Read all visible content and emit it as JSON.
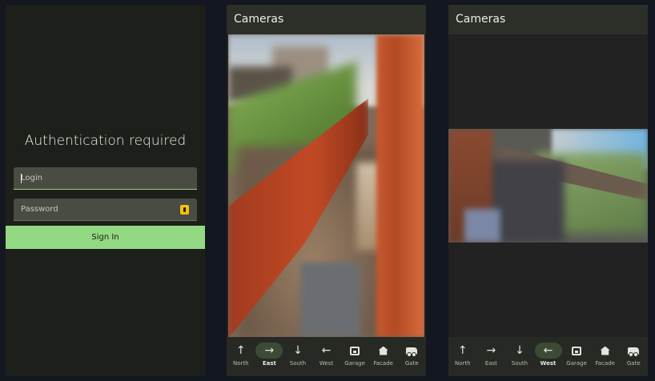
{
  "login": {
    "title": "Authentication required",
    "login_placeholder": "Login",
    "password_placeholder": "Password",
    "sign_in_label": "Sign In"
  },
  "cameras_east": {
    "title": "Cameras",
    "active_tab": "East"
  },
  "cameras_west": {
    "title": "Cameras",
    "active_tab": "West"
  },
  "nav": {
    "items": [
      {
        "label": "North",
        "icon": "arrow-up-icon"
      },
      {
        "label": "East",
        "icon": "arrow-right-icon"
      },
      {
        "label": "South",
        "icon": "arrow-down-icon"
      },
      {
        "label": "West",
        "icon": "arrow-left-icon"
      },
      {
        "label": "Garage",
        "icon": "garage-icon"
      },
      {
        "label": "Facade",
        "icon": "house-icon"
      },
      {
        "label": "Gate",
        "icon": "van-icon"
      }
    ]
  },
  "colors": {
    "accent": "#93d882",
    "background": "#1f211d",
    "appbar": "#2b2f28",
    "key_icon": "#f4c20d"
  }
}
